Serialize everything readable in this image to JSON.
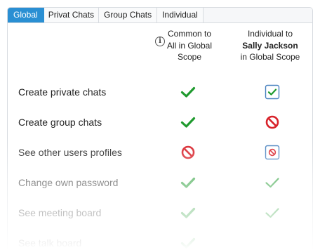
{
  "tabs": [
    {
      "label": "Global",
      "active": true
    },
    {
      "label": "Privat Chats",
      "active": false
    },
    {
      "label": "Group Chats",
      "active": false
    },
    {
      "label": "Individual",
      "active": false
    }
  ],
  "header": {
    "common_label": "Common to All in Global Scope",
    "common_line1": "Common to",
    "common_line2": "All in Global",
    "common_line3": "Scope",
    "individual_line1": "Individual to",
    "individual_name": "Sally Jackson",
    "individual_line3": "in Global Scope",
    "info_glyph": "i"
  },
  "rows": [
    {
      "label": "Create private chats",
      "common": "check",
      "individual": "check-box"
    },
    {
      "label": "Create group chats",
      "common": "check",
      "individual": "deny"
    },
    {
      "label": "See other users profiles",
      "common": "deny",
      "individual": "deny-box"
    },
    {
      "label": "Change own password",
      "common": "check",
      "individual": "check"
    },
    {
      "label": "See meeting board",
      "common": "check",
      "individual": "check"
    },
    {
      "label": "See talk board",
      "common": "check",
      "individual": ""
    }
  ],
  "colors": {
    "accent": "#2a8fd3",
    "check": "#1f9a2e",
    "deny": "#d8222a",
    "box_border": "#4a83c0"
  }
}
